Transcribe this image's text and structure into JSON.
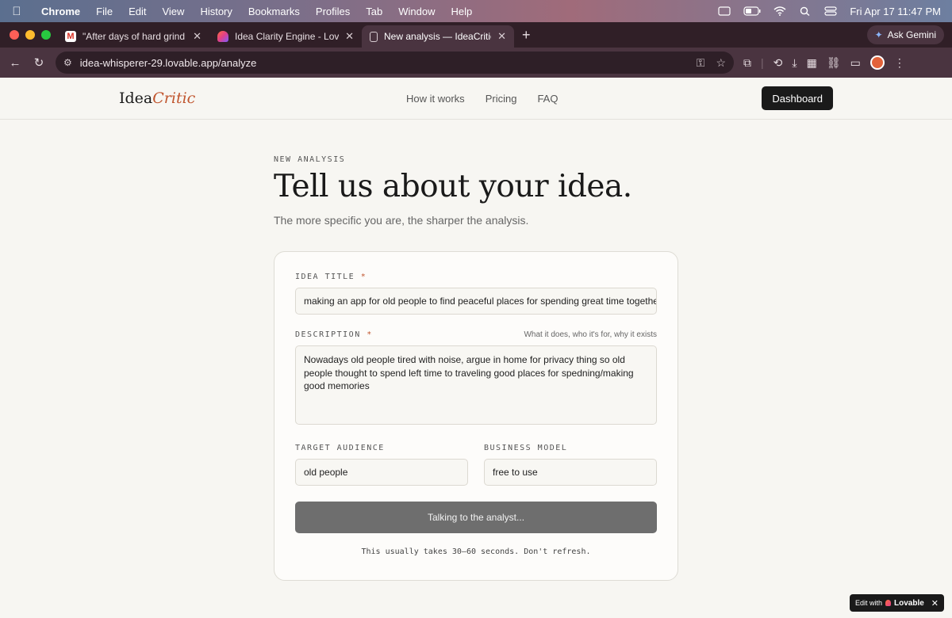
{
  "menubar": {
    "items": [
      "Chrome",
      "File",
      "Edit",
      "View",
      "History",
      "Bookmarks",
      "Profiles",
      "Tab",
      "Window",
      "Help"
    ],
    "datetime": "Fri Apr 17  11:47 PM"
  },
  "tabs": [
    {
      "title": "\"After days of hard grind in sil",
      "icon": "gmail-icon"
    },
    {
      "title": "Idea Clarity Engine - Lovable",
      "icon": "lovable-icon"
    },
    {
      "title": "New analysis — IdeaCritic",
      "icon": "page-icon",
      "active": true
    }
  ],
  "gemini_label": "Ask Gemini",
  "address": "idea-whisperer-29.lovable.app/analyze",
  "site": {
    "logo_main": "Idea",
    "logo_accent": "Critic",
    "nav": [
      "How it works",
      "Pricing",
      "FAQ"
    ],
    "dashboard_label": "Dashboard"
  },
  "hero": {
    "eyebrow": "NEW ANALYSIS",
    "title": "Tell us about your idea.",
    "subtitle": "The more specific you are, the sharper the analysis."
  },
  "form": {
    "title_label": "IDEA TITLE",
    "title_value": "making an app for old people to find peaceful places for spending great time together",
    "description_label": "DESCRIPTION",
    "description_hint": "What it does, who it's for, why it exists",
    "description_value": "Nowadays old people tired with noise, argue in home for privacy thing so old people thought to spend left time to traveling good places for spedning/making good memories",
    "audience_label": "TARGET AUDIENCE",
    "audience_value": "old people",
    "model_label": "BUSINESS MODEL",
    "model_value": "free to use",
    "submit_label": "Talking to the analyst...",
    "note": "This usually takes 30–60 seconds. Don't refresh.",
    "required_mark": "*"
  },
  "badge": {
    "edit_with": "Edit with",
    "brand": "Lovable"
  },
  "colors": {
    "accent": "#c0552e",
    "dark": "#1a1a1a",
    "page_bg": "#f7f6f2"
  }
}
